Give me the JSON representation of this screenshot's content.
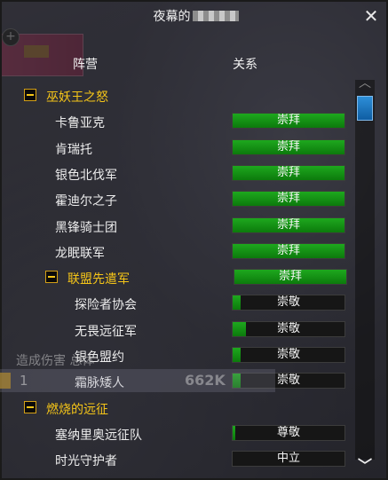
{
  "window": {
    "title": "夜幕的",
    "close_icon": "close-icon"
  },
  "columns": {
    "faction": "阵营",
    "standing": "关系"
  },
  "rows": [
    {
      "type": "header",
      "name": "巫妖王之怒",
      "indent": 0
    },
    {
      "type": "faction",
      "name": "卡鲁亚克",
      "standing": "崇拜",
      "progress": 1.0
    },
    {
      "type": "faction",
      "name": "肯瑞托",
      "standing": "崇拜",
      "progress": 1.0
    },
    {
      "type": "faction",
      "name": "银色北伐军",
      "standing": "崇拜",
      "progress": 1.0
    },
    {
      "type": "faction",
      "name": "霍迪尔之子",
      "standing": "崇拜",
      "progress": 1.0
    },
    {
      "type": "faction",
      "name": "黑锋骑士团",
      "standing": "崇拜",
      "progress": 1.0
    },
    {
      "type": "faction",
      "name": "龙眠联军",
      "standing": "崇拜",
      "progress": 1.0
    },
    {
      "type": "subheader",
      "name": "联盟先遣军",
      "standing": "崇拜",
      "progress": 1.0
    },
    {
      "type": "subfaction",
      "name": "探险者协会",
      "standing": "崇敬",
      "progress": 0.07
    },
    {
      "type": "subfaction",
      "name": "无畏远征军",
      "standing": "崇敬",
      "progress": 0.12
    },
    {
      "type": "subfaction",
      "name": "银色盟约",
      "standing": "崇敬",
      "progress": 0.07
    },
    {
      "type": "subfaction",
      "name": "霜脉矮人",
      "standing": "崇敬",
      "progress": 0.07
    },
    {
      "type": "header",
      "name": "燃烧的远征",
      "indent": 0
    },
    {
      "type": "faction",
      "name": "塞纳里奥远征队",
      "standing": "尊敬",
      "progress": 0.02
    },
    {
      "type": "faction",
      "name": "时光守护者",
      "standing": "中立",
      "progress": 0.0
    }
  ],
  "meter": {
    "title": "造成伤害",
    "subtitle": "总体",
    "rank": "1",
    "value": "662K"
  },
  "scroll": {
    "up_icon": "chevron-up-icon",
    "down_icon": "chevron-down-icon"
  },
  "colors": {
    "header_text": "#f5c518",
    "bar_fill": "#1ea81e"
  }
}
